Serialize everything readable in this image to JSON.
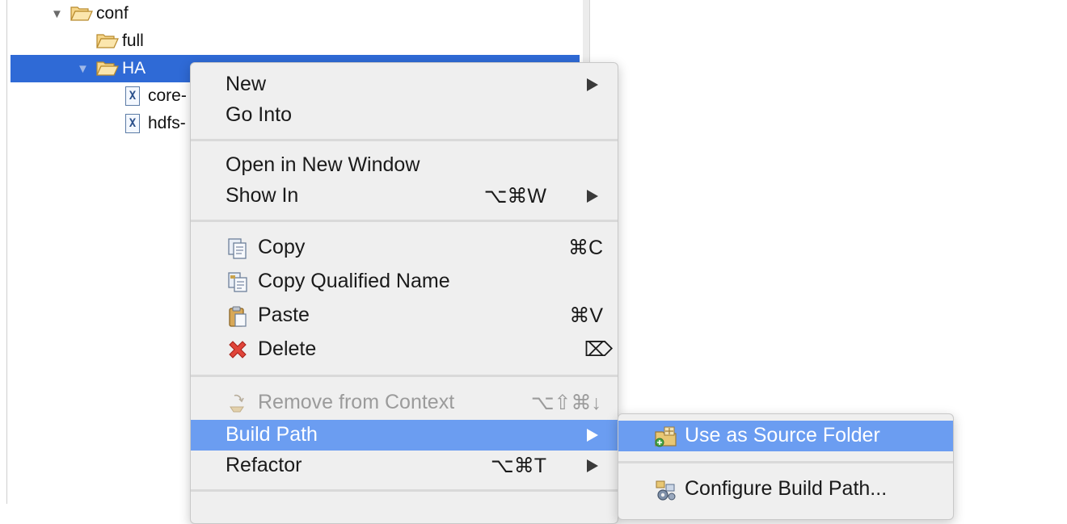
{
  "tree": {
    "items": [
      {
        "label": "conf",
        "expanded": true
      },
      {
        "label": "full"
      },
      {
        "label": "HA",
        "expanded": true,
        "selected": true
      },
      {
        "label": "core-",
        "icon": "xml-file-icon"
      },
      {
        "label": "hdfs-",
        "icon": "xml-file-icon"
      }
    ],
    "xml_glyph": "X"
  },
  "context_menu": {
    "items": {
      "new": {
        "label": "New"
      },
      "go_into": {
        "label": "Go Into"
      },
      "open_new_window": {
        "label": "Open in New Window"
      },
      "show_in": {
        "label": "Show In",
        "shortcut": "⌥⌘W"
      },
      "copy": {
        "label": "Copy",
        "shortcut": "⌘C",
        "icon": "copy-icon"
      },
      "copy_qualified": {
        "label": "Copy Qualified Name",
        "icon": "copy-qualified-name-icon"
      },
      "paste": {
        "label": "Paste",
        "shortcut": "⌘V",
        "icon": "paste-icon"
      },
      "delete": {
        "label": "Delete",
        "shortcut": "⌦",
        "icon": "delete-icon"
      },
      "remove_context": {
        "label": "Remove from Context",
        "shortcut": "⌥⇧⌘↓",
        "icon": "remove-from-context-icon",
        "disabled": true
      },
      "build_path": {
        "label": "Build Path",
        "active": true
      },
      "refactor": {
        "label": "Refactor",
        "shortcut": "⌥⌘T"
      }
    }
  },
  "build_path_submenu": {
    "items": {
      "use_source": {
        "label": "Use as Source Folder",
        "icon": "source-folder-icon",
        "active": true
      },
      "configure": {
        "label": "Configure Build Path...",
        "icon": "configure-build-path-icon"
      }
    }
  },
  "colors": {
    "selection": "#2f6ad6",
    "menu_highlight": "#6b9df1",
    "menu_background": "#efefef"
  }
}
